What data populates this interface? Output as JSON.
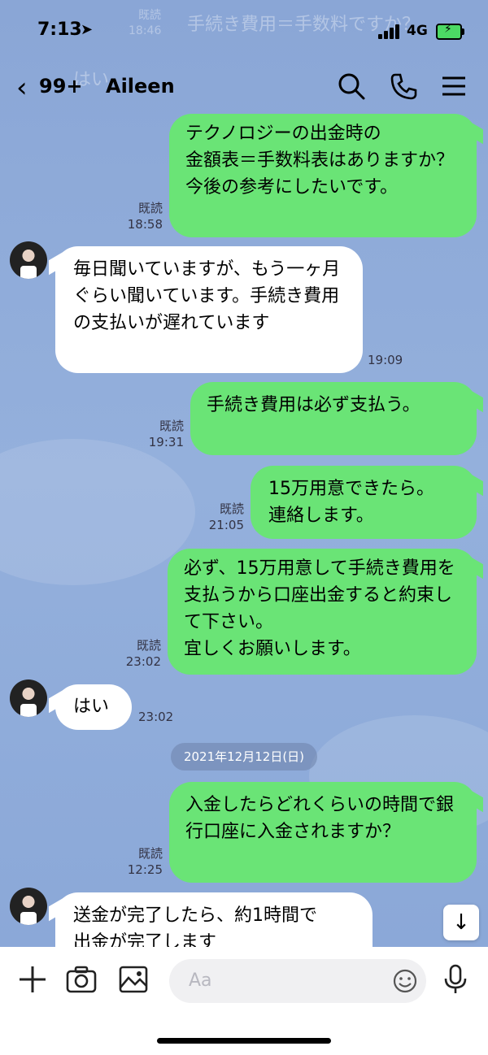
{
  "status": {
    "time": "7:13",
    "network": "4G"
  },
  "header": {
    "back_count": "99+",
    "contact_name": "Aileen"
  },
  "faded_top": {
    "meta_read": "既読",
    "meta_time": "18:46",
    "msg": "手続き費用＝手数料ですか？",
    "reply": "はい"
  },
  "messages": [
    {
      "dir": "out",
      "lines": [
        "テクノロジーの出金時の",
        "金額表＝手数料表はありますか？",
        "今後の参考にしたいです。"
      ],
      "read": "既読",
      "time": "18:58"
    },
    {
      "dir": "in",
      "lines": [
        "毎日聞いていますが、もう一ヶ月ぐらい聞いています。手続き費用の支払いが遅れています"
      ],
      "time": "19:09"
    },
    {
      "dir": "out",
      "lines": [
        "手続き費用は必ず支払う。"
      ],
      "read": "既読",
      "time": "19:31"
    },
    {
      "dir": "out",
      "lines": [
        "15万用意できたら。",
        "連絡します。"
      ],
      "read": "既読",
      "time": "21:05"
    },
    {
      "dir": "out",
      "lines": [
        "必ず、15万用意して手続き費用を支払うから口座出金すると約束して下さい。",
        "宜しくお願いします。"
      ],
      "read": "既読",
      "time": "23:02"
    },
    {
      "dir": "in",
      "lines": [
        "はい"
      ],
      "time": "23:02"
    },
    {
      "dir": "out",
      "lines": [
        "入金したらどれくらいの時間で銀行口座に入金されますか？"
      ],
      "read": "既読",
      "time": "12:25"
    },
    {
      "dir": "in",
      "lines": [
        "送金が完了したら、約1時間で",
        "出金が完了します"
      ],
      "time": ""
    }
  ],
  "date_separator": "2021年12月12日(日)",
  "composer": {
    "placeholder": "Aa"
  }
}
